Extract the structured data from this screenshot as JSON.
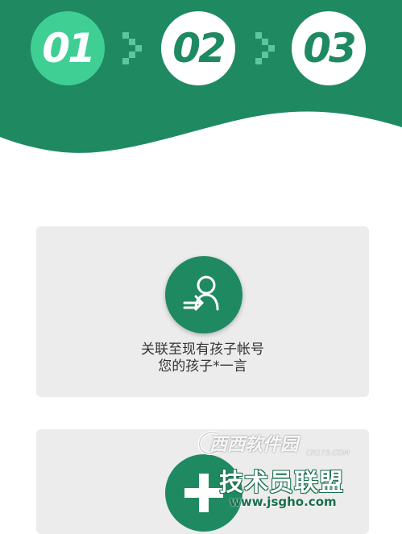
{
  "steps": [
    {
      "label": "01",
      "active": true
    },
    {
      "label": "02",
      "active": false
    },
    {
      "label": "03",
      "active": false
    }
  ],
  "cards": [
    {
      "icon": "link-user-icon",
      "line1": "关联至现有孩子帐号",
      "line2": "您的孩子*一言"
    },
    {
      "icon": "plus-icon"
    }
  ],
  "watermark": {
    "brand_top": "西西软件园",
    "brand_sub": "CR173.COM",
    "brand_main": "技术员联盟",
    "url": "www.jsgho.com"
  },
  "colors": {
    "header_green": "#1f8a62",
    "active_step": "#3fcf94",
    "card_bg": "#ececec"
  }
}
